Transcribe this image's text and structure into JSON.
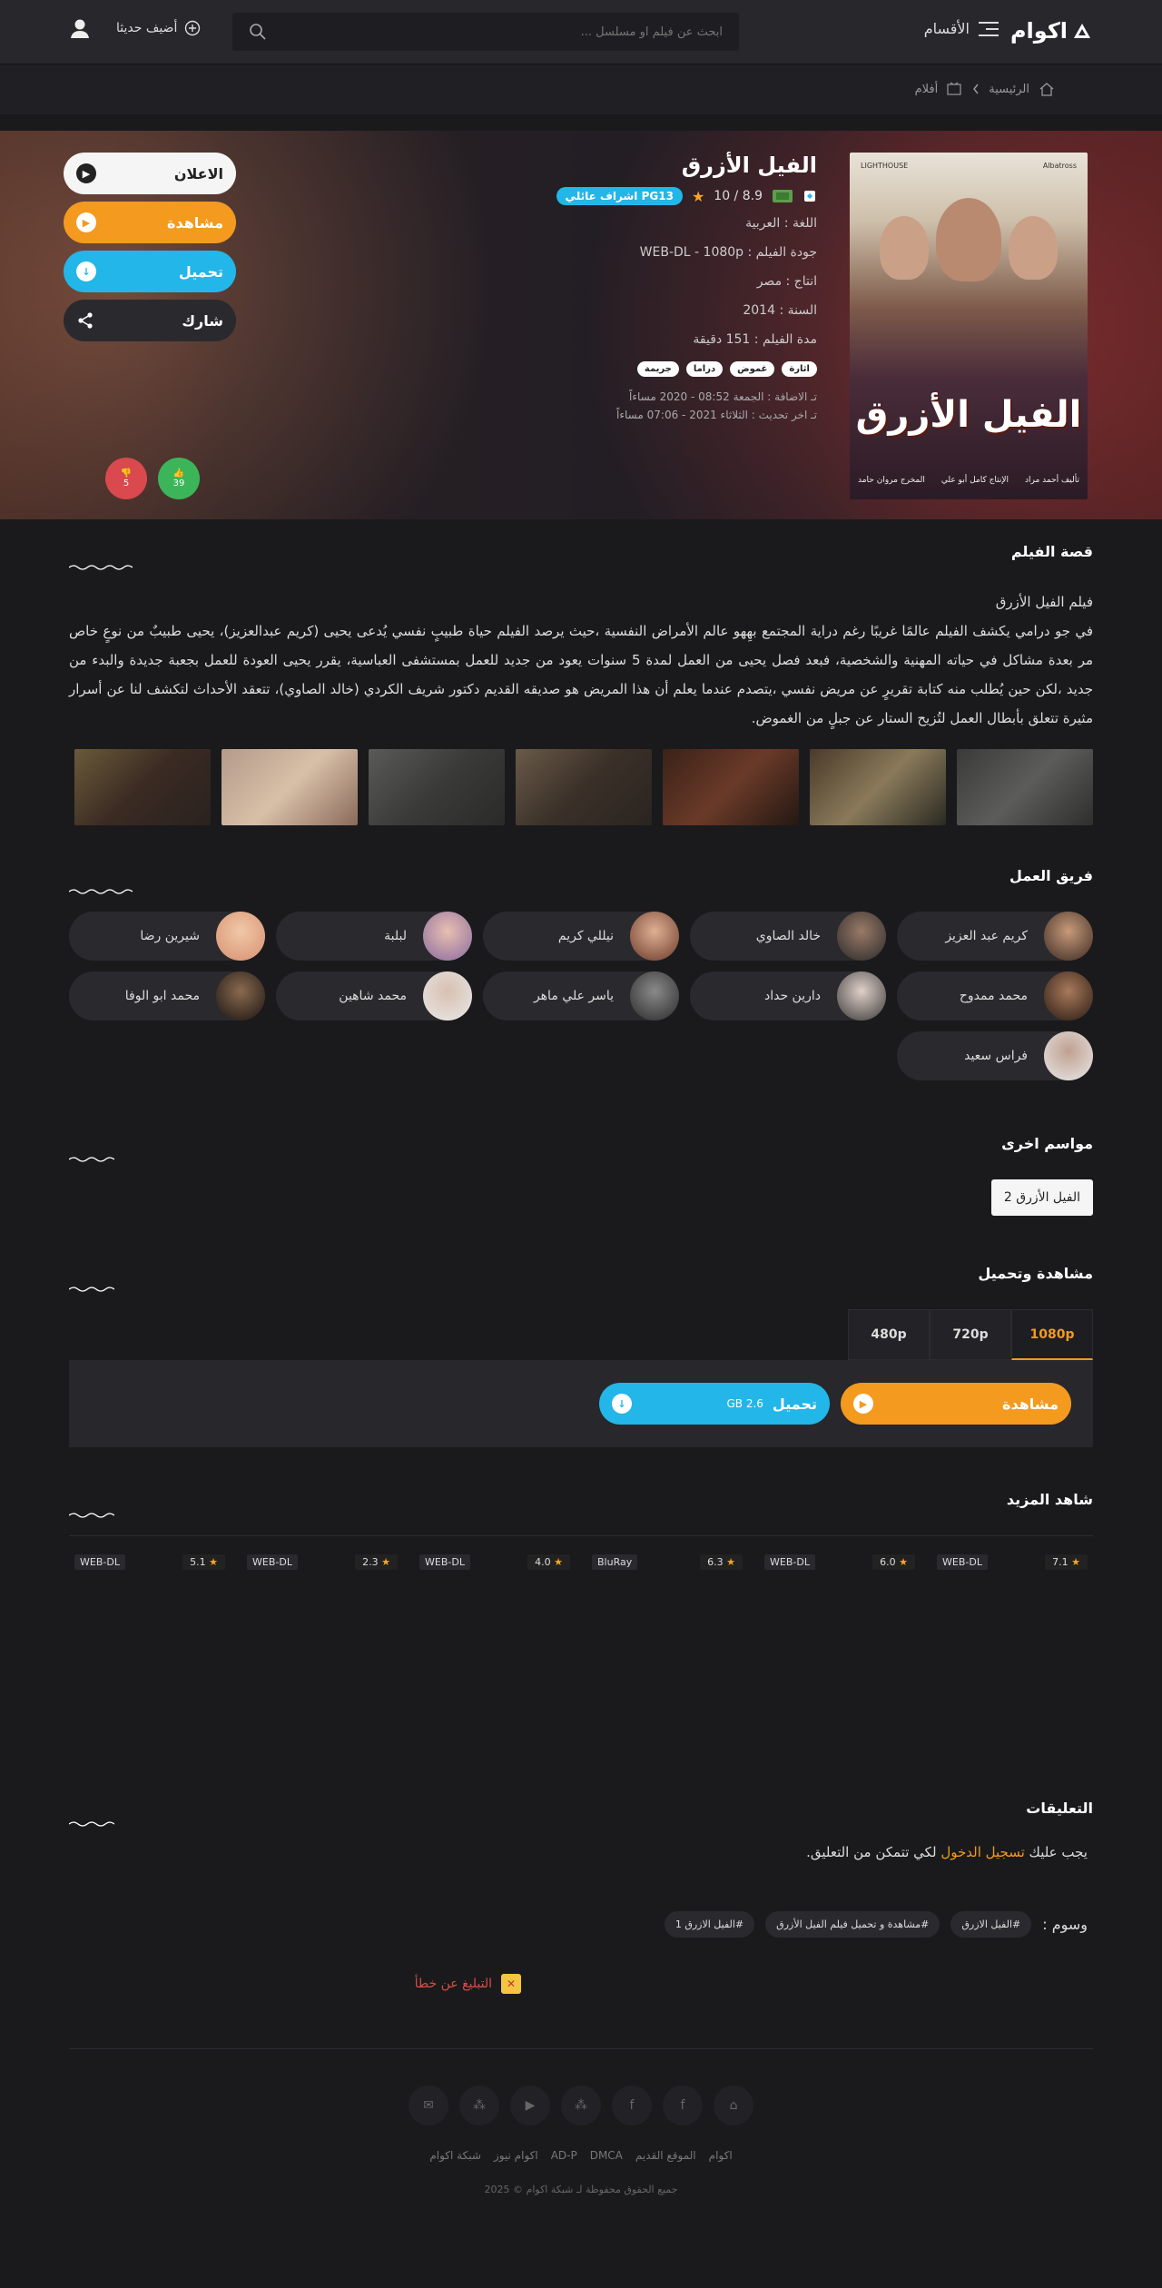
{
  "header": {
    "logo": "اكوام",
    "menu_label": "الأقسام",
    "search_placeholder": "ابحث عن فيلم او مسلسل ...",
    "add_label": "أضيف حديثا"
  },
  "breadcrumb": {
    "home": "الرئيسية",
    "movies": "أفلام"
  },
  "movie": {
    "title": "الفيل الأزرق",
    "rating": "8.9 / 10",
    "pg": "PG13 اشراف عائلي",
    "language": "اللغة : العربية",
    "quality": "جودة الفيلم : WEB-DL - 1080p",
    "country": "انتاج : مصر",
    "year": "السنة : 2014",
    "duration": "مدة الفيلم : 151 دقيقة",
    "tags": [
      "اثارة",
      "غموض",
      "دراما",
      "جريمة"
    ],
    "added": "تـ الاضافة : الجمعة 08:52 - 2020 مساءاً",
    "updated": "تـ اخر تحديث : الثلاثاء 2021 - 07:06 مساءاً",
    "poster_title": "الفيل الأزرق",
    "poster_credits": [
      "تأليف أحمد مراد",
      "المخرج مروان حامد",
      "الإنتاج كامل أبو علي"
    ],
    "poster_studios": [
      "Albatross",
      "LIGHTHOUSE"
    ]
  },
  "actions": {
    "trailer": "الاعلان",
    "watch": "مشاهدة",
    "download": "تحميل",
    "share": "شارك",
    "likes": "39",
    "dislikes": "5"
  },
  "story": {
    "title": "قصة الفيلم",
    "heading": "فيلم الفيل الأزرق",
    "text": "في جو درامي يكشف الفيلم عالمًا غريبًا رغم دراية المجتمع بهِهو عالم الأمراض النفسية ،حيث يرصد الفيلم حياة طبيبٍ نفسي يُدعى يحيى (كريم عبدالعزيز)، يحيى طبيبٌ من نوعٍ خاص مر بعدة مشاكل في حياته المهنية والشخصية، فبعد فصل يحيى من العمل لمدة 5 سنوات يعود من جديد للعمل بمستشفى العباسية، يقرر يحيى العودة للعمل بجعبة جديدة والبدء من جديد ،لكن حين يُطلب منه كتابة تقريرٍ عن مريض نفسي ،يتصدم عندما يعلم أن هذا المريض هو صديقه القديم دكتور شريف الكردي (خالد الصاوي)، تتعقد الأحداث لتكشف لنا عن أسرار مثيرة تتعلق بأبطال العمل لتُزيح الستار عن جبلٍ من الغموض."
  },
  "cast": {
    "title": "فريق العمل",
    "members": [
      "كريم عبد العزيز",
      "خالد الصاوي",
      "نيللي كريم",
      "لبلبة",
      "شيرين رضا",
      "محمد ممدوح",
      "دارين حداد",
      "ياسر علي ماهر",
      "محمد شاهين",
      "محمد ابو الوفا",
      "فراس سعيد"
    ]
  },
  "seasons": {
    "title": "مواسم اخرى",
    "item": "الفيل الأزرق 2"
  },
  "watch_download": {
    "title": "مشاهدة وتحميل",
    "tabs": [
      "1080p",
      "720p",
      "480p"
    ],
    "watch": "مشاهدة",
    "download": "تحميل",
    "size": "2.6 GB"
  },
  "more": {
    "title": "شاهد المزيد",
    "cards": [
      {
        "rating": "7.1",
        "quality": "WEB-DL"
      },
      {
        "rating": "6.0",
        "quality": "WEB-DL"
      },
      {
        "rating": "6.3",
        "quality": "BluRay"
      },
      {
        "rating": "4.0",
        "quality": "WEB-DL"
      },
      {
        "rating": "2.3",
        "quality": "WEB-DL"
      },
      {
        "rating": "5.1",
        "quality": "WEB-DL"
      }
    ]
  },
  "comments": {
    "title": "التعليقات",
    "pre": "يجب عليك",
    "login": "تسجيل الدخول",
    "post": "لكي تتمكن من التعليق."
  },
  "keywords": {
    "label": "وسوم :",
    "items": [
      "#الفيل الازرق",
      "#مشاهدة و تحميل فيلم الفيل الأزرق",
      "#الفيل الازرق 1"
    ]
  },
  "report": "التبليغ عن خطأ",
  "footer": {
    "links": [
      "اكوام",
      "الموقع القديم",
      "DMCA",
      "AD-P",
      "اكوام نيوز",
      "شبكة اكوام"
    ],
    "copyright": "جميع الحقوق محفوظة لـ شبكة اكوام © 2025"
  },
  "colors": {
    "accent": "#f39a1f",
    "download": "#23b6e8",
    "like": "#3cb55a",
    "dislike": "#d9494e"
  }
}
